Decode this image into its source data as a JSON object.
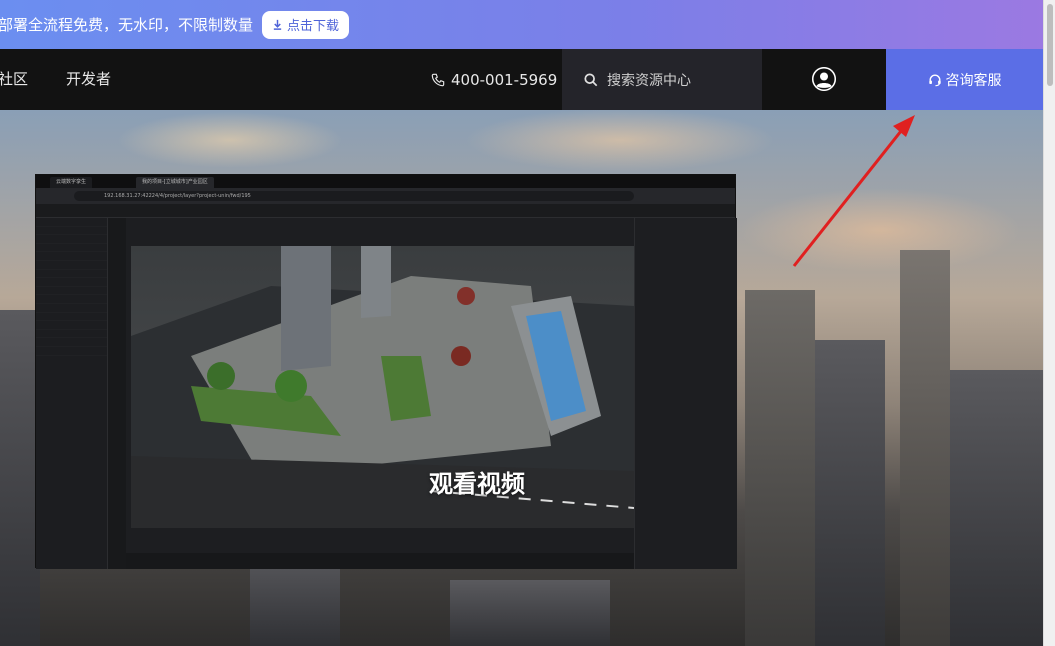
{
  "promo": {
    "text": "部署全流程免费，无水印，不限制数量",
    "button_label": "点击下载"
  },
  "nav": {
    "items": [
      "社区",
      "开发者"
    ],
    "phone": "400-001-5969",
    "search_placeholder": "搜索资源中心",
    "consult_label": "咨询客服"
  },
  "video_card": {
    "watch_label": "观看视频",
    "url_text": "192.168.31.27:42224/4/project/layer?project-unin/fwd/195",
    "tabs": [
      "云端数字孪生",
      "我的项目-[立城城市]产业园区"
    ]
  },
  "colors": {
    "banner_start": "#6b8ef0",
    "banner_end": "#9b79e2",
    "nav_bg": "#121212",
    "consult_bg": "#5b6ee6",
    "arrow": "#e02020"
  }
}
